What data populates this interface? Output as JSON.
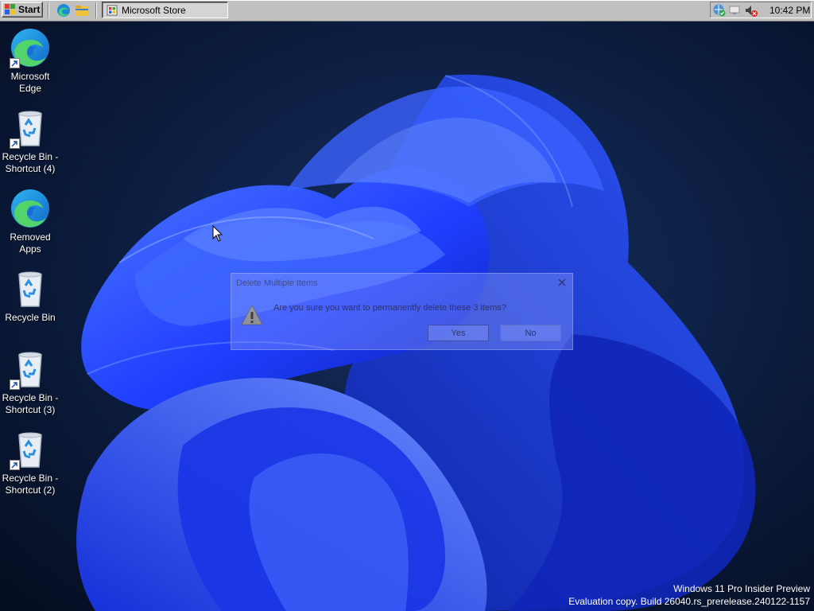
{
  "taskbar": {
    "start_label": "Start",
    "quick_launch": [
      {
        "icon": "edge-icon"
      },
      {
        "icon": "file-explorer-icon"
      }
    ],
    "task": {
      "label": "Microsoft Store",
      "icon": "store-icon"
    },
    "tray": {
      "icons": [
        "network-shield-icon",
        "network-icon",
        "volume-muted-icon"
      ],
      "clock": "10:42 PM"
    }
  },
  "desktop": {
    "icons": [
      {
        "label_line1": "Microsoft",
        "label_line2": "Edge",
        "icon": "edge-icon",
        "shortcut": true
      },
      {
        "label_line1": "Recycle Bin -",
        "label_line2": "Shortcut (4)",
        "icon": "recycle-bin-icon",
        "shortcut": true
      },
      {
        "label_line1": "Removed",
        "label_line2": "Apps",
        "icon": "edge-icon",
        "shortcut": false
      },
      {
        "label_line1": "Recycle Bin",
        "label_line2": "",
        "icon": "recycle-bin-icon",
        "shortcut": false
      },
      {
        "label_line1": "Recycle Bin -",
        "label_line2": "Shortcut (3)",
        "icon": "recycle-bin-icon",
        "shortcut": true
      },
      {
        "label_line1": "Recycle Bin -",
        "label_line2": "Shortcut (2)",
        "icon": "recycle-bin-icon",
        "shortcut": true
      }
    ]
  },
  "dialog": {
    "title": "Delete Multiple Items",
    "message": "Are you sure you want to permanently delete these 3 items?",
    "yes_label": "Yes",
    "no_label": "No",
    "icon": "warning-icon"
  },
  "watermark": {
    "line1": "Windows 11 Pro Insider Preview",
    "line2": "Evaluation copy. Build 26040.rs_prerelease.240122-1157"
  },
  "colors": {
    "wallpaper_dark": "#0a1630",
    "wallpaper_bloom": "#1e3cff",
    "taskbar": "#c0c0c0"
  }
}
